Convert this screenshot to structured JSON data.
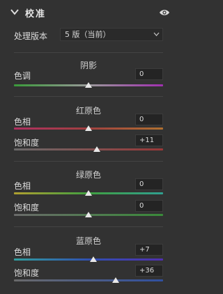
{
  "header": {
    "title": "校准",
    "chevron_icon": "chevron-down-icon",
    "visibility_icon": "eye-icon"
  },
  "version": {
    "label": "处理版本",
    "value": "5 版（当前）"
  },
  "sections": [
    {
      "title": "阴影",
      "rows": [
        {
          "label": "色调",
          "value": "0",
          "amount": 0
        }
      ]
    },
    {
      "title": "红原色",
      "rows": [
        {
          "label": "色相",
          "value": "0",
          "amount": 0
        },
        {
          "label": "饱和度",
          "value": "+11",
          "amount": 11
        }
      ]
    },
    {
      "title": "绿原色",
      "rows": [
        {
          "label": "色相",
          "value": "0",
          "amount": 0
        },
        {
          "label": "饱和度",
          "value": "0",
          "amount": 0
        }
      ]
    },
    {
      "title": "蓝原色",
      "rows": [
        {
          "label": "色相",
          "value": "+7",
          "amount": 7
        },
        {
          "label": "饱和度",
          "value": "+36",
          "amount": 36
        }
      ]
    }
  ],
  "colors": {
    "background": "#323232",
    "shadow_tint_track": [
      "#3a9a3a",
      "#9a9a9a",
      "#a030b0"
    ],
    "red_hue_track": [
      "#b03060",
      "#a04040",
      "#b07030"
    ],
    "red_sat_track": [
      "#6a6a6a",
      "#9a3838"
    ],
    "green_hue_track": [
      "#b0a030",
      "#40a040",
      "#30a090"
    ],
    "green_sat_track": [
      "#6a6a6a",
      "#3a8a3a"
    ],
    "blue_hue_track": [
      "#30a0a0",
      "#3050b0",
      "#5030b0"
    ],
    "blue_sat_track": [
      "#6a6a6a",
      "#3050a0"
    ]
  }
}
